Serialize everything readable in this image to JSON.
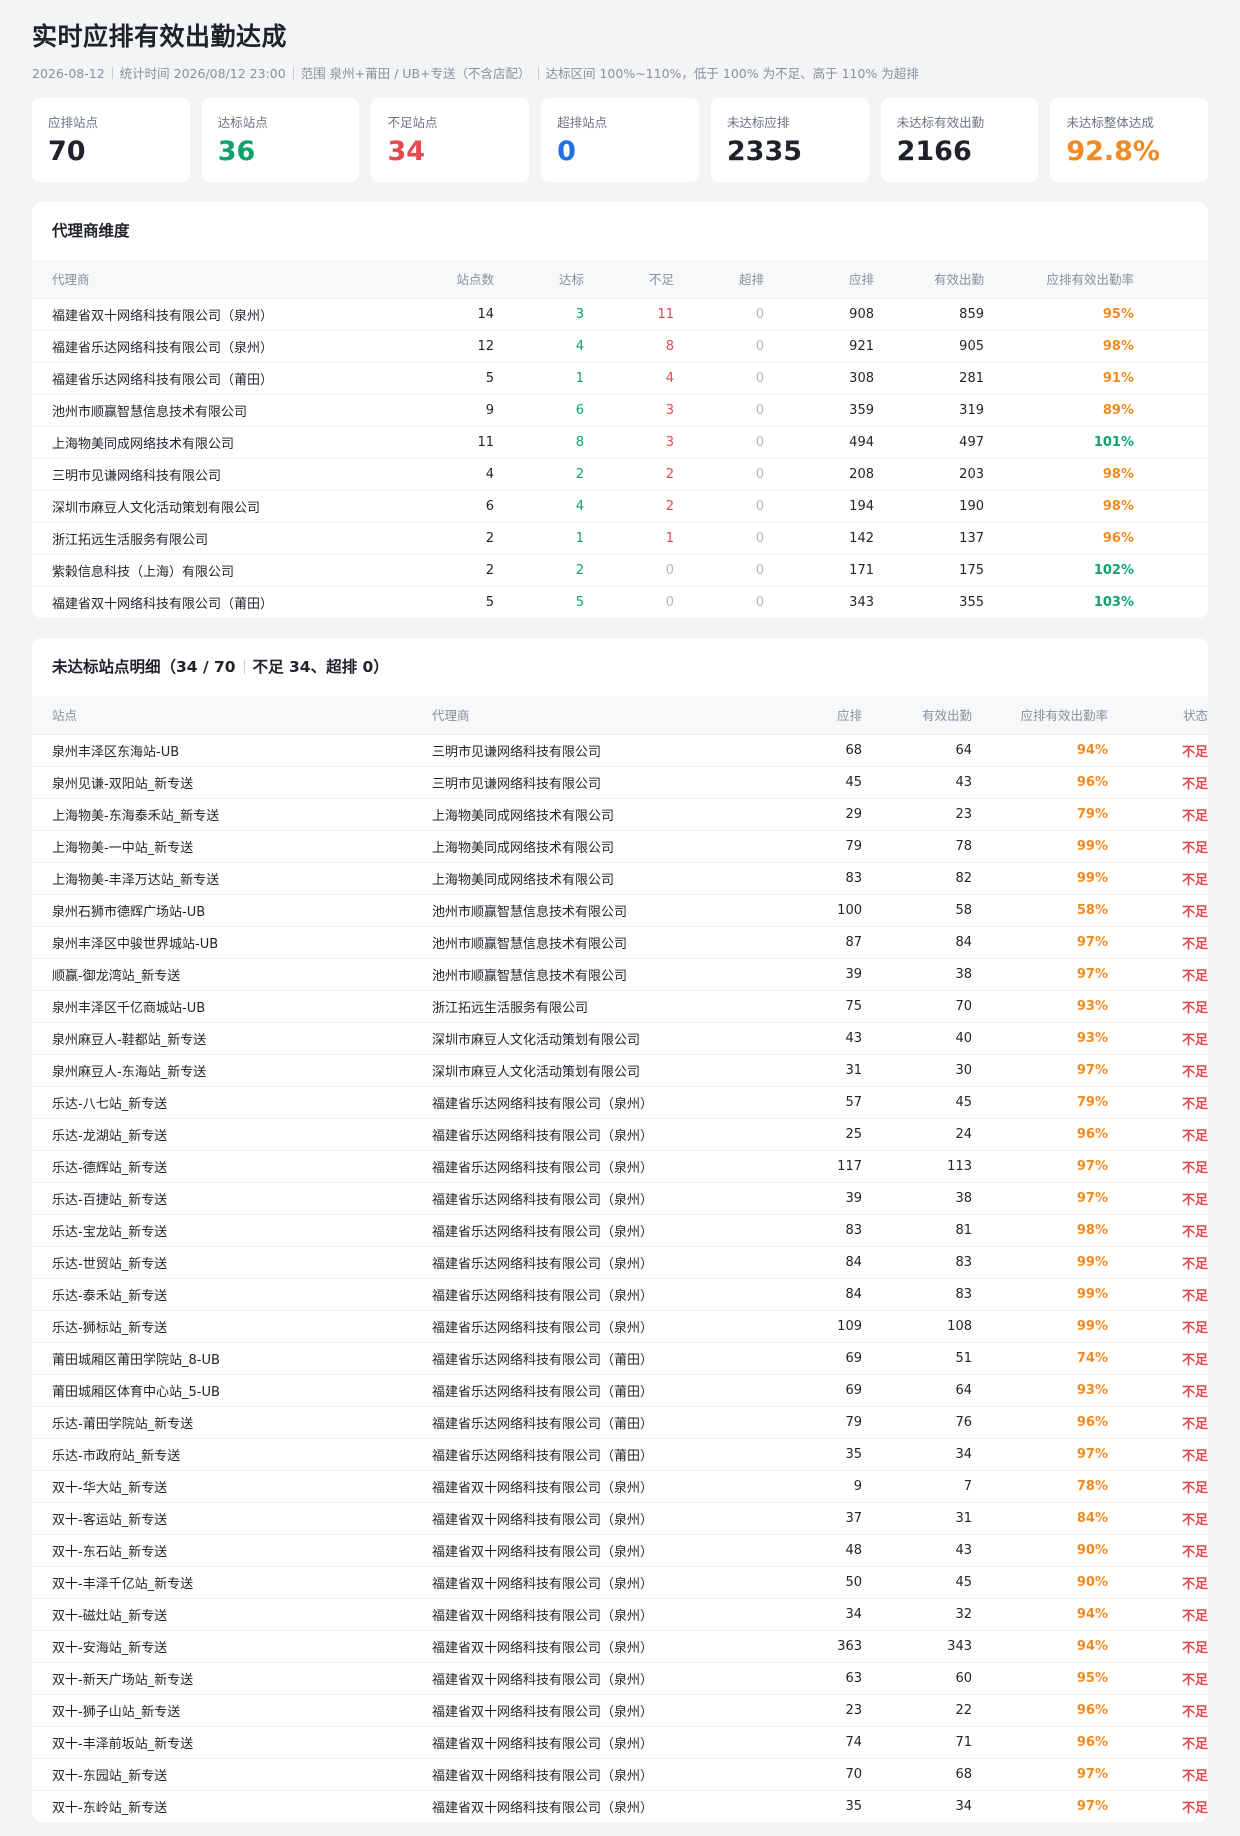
{
  "header": {
    "title": "实时应排有效出勤达成",
    "date": "2026-08-12",
    "stat_time": "统计时间 2026/08/12 23:00",
    "scope": "范围 泉州+莆田 / UB+专送（不含店配）",
    "rule": "达标区间 100%~110%，低于 100% 为不足、高于 110% 为超排"
  },
  "kpis": [
    {
      "label": "应排站点",
      "value": "70"
    },
    {
      "label": "达标站点",
      "value": "36"
    },
    {
      "label": "不足站点",
      "value": "34"
    },
    {
      "label": "超排站点",
      "value": "0"
    },
    {
      "label": "未达标应排",
      "value": "2335"
    },
    {
      "label": "未达标有效出勤",
      "value": "2166"
    },
    {
      "label": "未达标整体达成",
      "value": "92.8%"
    }
  ],
  "colors": {
    "green": "#0fa36b",
    "red": "#e5484d",
    "blue": "#1f6fe5",
    "orange": "#f08a24"
  },
  "agent_table": {
    "title": "代理商维度",
    "columns": [
      "代理商",
      "站点数",
      "达标",
      "不足",
      "超排",
      "应排",
      "有效出勤",
      "应排有效出勤率"
    ],
    "rows": [
      [
        "福建省双十网络科技有限公司（泉州）",
        "14",
        "3",
        "11",
        "0",
        "908",
        "859",
        "95%"
      ],
      [
        "福建省乐达网络科技有限公司（泉州）",
        "12",
        "4",
        "8",
        "0",
        "921",
        "905",
        "98%"
      ],
      [
        "福建省乐达网络科技有限公司（莆田）",
        "5",
        "1",
        "4",
        "0",
        "308",
        "281",
        "91%"
      ],
      [
        "池州市顺赢智慧信息技术有限公司",
        "9",
        "6",
        "3",
        "0",
        "359",
        "319",
        "89%"
      ],
      [
        "上海物美同成网络技术有限公司",
        "11",
        "8",
        "3",
        "0",
        "494",
        "497",
        "101%"
      ],
      [
        "三明市见谦网络科技有限公司",
        "4",
        "2",
        "2",
        "0",
        "208",
        "203",
        "98%"
      ],
      [
        "深圳市麻豆人文化活动策划有限公司",
        "6",
        "4",
        "2",
        "0",
        "194",
        "190",
        "98%"
      ],
      [
        "浙江拓远生活服务有限公司",
        "2",
        "1",
        "1",
        "0",
        "142",
        "137",
        "96%"
      ],
      [
        "紫榖信息科技（上海）有限公司",
        "2",
        "2",
        "0",
        "0",
        "171",
        "175",
        "102%"
      ],
      [
        "福建省双十网络科技有限公司（莆田）",
        "5",
        "5",
        "0",
        "0",
        "343",
        "355",
        "103%"
      ]
    ]
  },
  "site_table": {
    "title_main": "未达标站点明细（34 / 70",
    "title_sub": "不足 34、超排 0）",
    "columns": [
      "站点",
      "代理商",
      "应排",
      "有效出勤",
      "应排有效出勤率",
      "状态"
    ],
    "rows": [
      [
        "泉州丰泽区东海站-UB",
        "三明市见谦网络科技有限公司",
        "68",
        "64",
        "94%",
        "不足"
      ],
      [
        "泉州见谦-双阳站_新专送",
        "三明市见谦网络科技有限公司",
        "45",
        "43",
        "96%",
        "不足"
      ],
      [
        "上海物美-东海泰禾站_新专送",
        "上海物美同成网络技术有限公司",
        "29",
        "23",
        "79%",
        "不足"
      ],
      [
        "上海物美-一中站_新专送",
        "上海物美同成网络技术有限公司",
        "79",
        "78",
        "99%",
        "不足"
      ],
      [
        "上海物美-丰泽万达站_新专送",
        "上海物美同成网络技术有限公司",
        "83",
        "82",
        "99%",
        "不足"
      ],
      [
        "泉州石狮市德辉广场站-UB",
        "池州市顺赢智慧信息技术有限公司",
        "100",
        "58",
        "58%",
        "不足"
      ],
      [
        "泉州丰泽区中骏世界城站-UB",
        "池州市顺赢智慧信息技术有限公司",
        "87",
        "84",
        "97%",
        "不足"
      ],
      [
        "顺赢-御龙湾站_新专送",
        "池州市顺赢智慧信息技术有限公司",
        "39",
        "38",
        "97%",
        "不足"
      ],
      [
        "泉州丰泽区千亿商城站-UB",
        "浙江拓远生活服务有限公司",
        "75",
        "70",
        "93%",
        "不足"
      ],
      [
        "泉州麻豆人-鞋都站_新专送",
        "深圳市麻豆人文化活动策划有限公司",
        "43",
        "40",
        "93%",
        "不足"
      ],
      [
        "泉州麻豆人-东海站_新专送",
        "深圳市麻豆人文化活动策划有限公司",
        "31",
        "30",
        "97%",
        "不足"
      ],
      [
        "乐达-八七站_新专送",
        "福建省乐达网络科技有限公司（泉州）",
        "57",
        "45",
        "79%",
        "不足"
      ],
      [
        "乐达-龙湖站_新专送",
        "福建省乐达网络科技有限公司（泉州）",
        "25",
        "24",
        "96%",
        "不足"
      ],
      [
        "乐达-德辉站_新专送",
        "福建省乐达网络科技有限公司（泉州）",
        "117",
        "113",
        "97%",
        "不足"
      ],
      [
        "乐达-百捷站_新专送",
        "福建省乐达网络科技有限公司（泉州）",
        "39",
        "38",
        "97%",
        "不足"
      ],
      [
        "乐达-宝龙站_新专送",
        "福建省乐达网络科技有限公司（泉州）",
        "83",
        "81",
        "98%",
        "不足"
      ],
      [
        "乐达-世贸站_新专送",
        "福建省乐达网络科技有限公司（泉州）",
        "84",
        "83",
        "99%",
        "不足"
      ],
      [
        "乐达-泰禾站_新专送",
        "福建省乐达网络科技有限公司（泉州）",
        "84",
        "83",
        "99%",
        "不足"
      ],
      [
        "乐达-狮标站_新专送",
        "福建省乐达网络科技有限公司（泉州）",
        "109",
        "108",
        "99%",
        "不足"
      ],
      [
        "莆田城厢区莆田学院站_8-UB",
        "福建省乐达网络科技有限公司（莆田）",
        "69",
        "51",
        "74%",
        "不足"
      ],
      [
        "莆田城厢区体育中心站_5-UB",
        "福建省乐达网络科技有限公司（莆田）",
        "69",
        "64",
        "93%",
        "不足"
      ],
      [
        "乐达-莆田学院站_新专送",
        "福建省乐达网络科技有限公司（莆田）",
        "79",
        "76",
        "96%",
        "不足"
      ],
      [
        "乐达-市政府站_新专送",
        "福建省乐达网络科技有限公司（莆田）",
        "35",
        "34",
        "97%",
        "不足"
      ],
      [
        "双十-华大站_新专送",
        "福建省双十网络科技有限公司（泉州）",
        "9",
        "7",
        "78%",
        "不足"
      ],
      [
        "双十-客运站_新专送",
        "福建省双十网络科技有限公司（泉州）",
        "37",
        "31",
        "84%",
        "不足"
      ],
      [
        "双十-东石站_新专送",
        "福建省双十网络科技有限公司（泉州）",
        "48",
        "43",
        "90%",
        "不足"
      ],
      [
        "双十-丰泽千亿站_新专送",
        "福建省双十网络科技有限公司（泉州）",
        "50",
        "45",
        "90%",
        "不足"
      ],
      [
        "双十-磁灶站_新专送",
        "福建省双十网络科技有限公司（泉州）",
        "34",
        "32",
        "94%",
        "不足"
      ],
      [
        "双十-安海站_新专送",
        "福建省双十网络科技有限公司（泉州）",
        "363",
        "343",
        "94%",
        "不足"
      ],
      [
        "双十-新天广场站_新专送",
        "福建省双十网络科技有限公司（泉州）",
        "63",
        "60",
        "95%",
        "不足"
      ],
      [
        "双十-狮子山站_新专送",
        "福建省双十网络科技有限公司（泉州）",
        "23",
        "22",
        "96%",
        "不足"
      ],
      [
        "双十-丰泽前坂站_新专送",
        "福建省双十网络科技有限公司（泉州）",
        "74",
        "71",
        "96%",
        "不足"
      ],
      [
        "双十-东园站_新专送",
        "福建省双十网络科技有限公司（泉州）",
        "70",
        "68",
        "97%",
        "不足"
      ],
      [
        "双十-东岭站_新专送",
        "福建省双十网络科技有限公司（泉州）",
        "35",
        "34",
        "97%",
        "不足"
      ]
    ]
  }
}
